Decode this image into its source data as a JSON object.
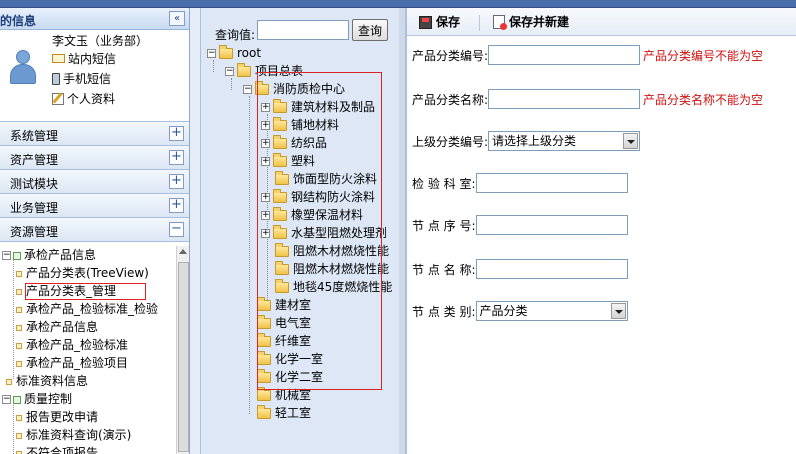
{
  "left": {
    "header_title": "我的信息",
    "collapse_glyph": "«",
    "user": {
      "name": "李文玉（业务部）",
      "links": [
        "站内短信",
        "手机短信",
        "个人资料"
      ]
    },
    "accordion": [
      {
        "label": "系统管理",
        "glyph": "+"
      },
      {
        "label": "资产管理",
        "glyph": "+"
      },
      {
        "label": "测试模块",
        "glyph": "+"
      },
      {
        "label": "业务管理",
        "glyph": "+"
      },
      {
        "label": "资源管理",
        "glyph": "−"
      }
    ],
    "tree": {
      "group1": "承检产品信息",
      "group1_items": [
        "产品分类表(TreeView)",
        "产品分类表_管理",
        "承检产品_检验标准_检验",
        "承检产品信息",
        "承检产品_检验标准",
        "承检产品_检验项目"
      ],
      "item_std": "标准资料信息",
      "group2": "质量控制",
      "group2_items": [
        "报告更改申请",
        "标准资料查询(演示)",
        "不符合项报告"
      ]
    }
  },
  "middle": {
    "query_label": "查询值:",
    "query_value": "",
    "query_button": "查询",
    "root": "root",
    "project": "项目总表",
    "center": "消防质检中心",
    "center_children": [
      {
        "label": "建筑材料及制品",
        "expandable": true
      },
      {
        "label": "铺地材料",
        "expandable": true
      },
      {
        "label": "纺织品",
        "expandable": true
      },
      {
        "label": "塑料",
        "expandable": true
      },
      {
        "label": "饰面型防火涂料",
        "expandable": false
      },
      {
        "label": "钢结构防火涂料",
        "expandable": true
      },
      {
        "label": "橡塑保温材料",
        "expandable": true
      },
      {
        "label": "水基型阻燃处理剂",
        "expandable": true
      },
      {
        "label": "阻燃木材燃烧性能",
        "expandable": false
      },
      {
        "label": "阻燃木材燃烧性能",
        "expandable": false
      },
      {
        "label": "地毯45度燃烧性能",
        "expandable": false
      }
    ],
    "rooms": [
      "建材室",
      "电气室",
      "纤维室",
      "化学一室",
      "化学二室",
      "机械室",
      "轻工室"
    ]
  },
  "form": {
    "toolbar": {
      "save": "保存",
      "save_new": "保存并新建"
    },
    "fields": [
      {
        "label": "产品分类编号:",
        "value": "",
        "error": "产品分类编号不能为空"
      },
      {
        "label": "产品分类名称:",
        "value": "",
        "error": "产品分类名称不能为空"
      },
      {
        "label": "上级分类编号:",
        "select": "请选择上级分类"
      },
      {
        "label": "检 验 科 室:",
        "value": ""
      },
      {
        "label": "节 点 序 号:",
        "value": ""
      },
      {
        "label": "节 点 名 称:",
        "value": ""
      },
      {
        "label": "节 点 类 别:",
        "select": "产品分类"
      }
    ]
  },
  "colors": {
    "error": "#d01010",
    "highlight_border": "#dd2222",
    "accent": "#4a6ea9"
  }
}
